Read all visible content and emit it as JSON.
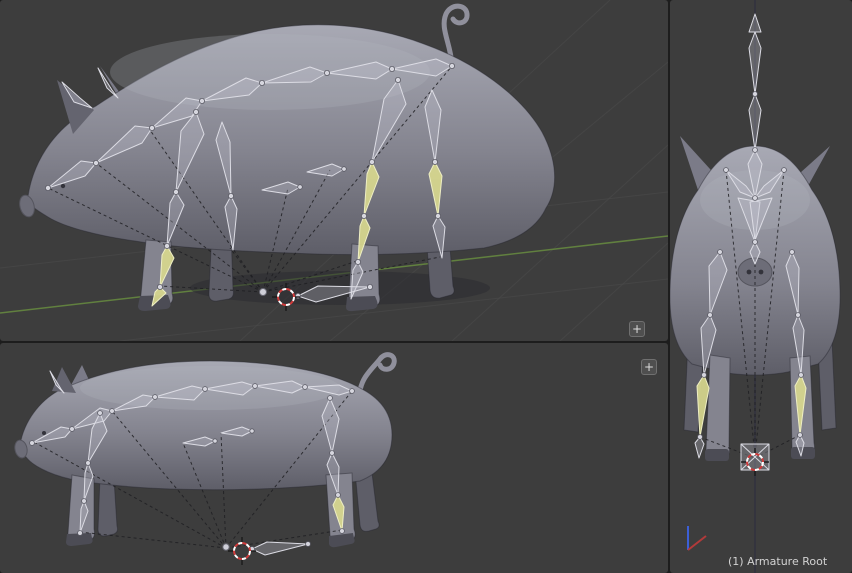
{
  "viewports": {
    "perspective": {
      "label": "perspective-view"
    },
    "side": {
      "label": "side-orthographic-view"
    },
    "front": {
      "label": "front-orthographic-view"
    }
  },
  "controls": {
    "expand_top_label": "+",
    "expand_bottom_label": "+",
    "expand_icon": "plus-icon"
  },
  "status": {
    "active_object": "(1) Armature Root"
  },
  "cursor": {
    "icon": "3d-cursor-icon"
  },
  "colors": {
    "viewport_bg": "#3d3d3d",
    "separator": "#1d1d1d",
    "grid_line": "#4a4a4a",
    "axis_green": "#61803f",
    "axis_dark": "#32323e",
    "bone_outline": "#dcdce4",
    "bone_fill": "rgba(200,200,212,0.30)",
    "bone_selected": "#d8d88e",
    "mesh_light": "#a8a9b4",
    "mesh_mid": "#84848f",
    "mesh_dark": "#5e5e68",
    "cursor_red": "#cf3b3b",
    "gizmo_red": "#b23a3a",
    "gizmo_blue": "#3c5fd6",
    "text": "#d2d2d2"
  }
}
